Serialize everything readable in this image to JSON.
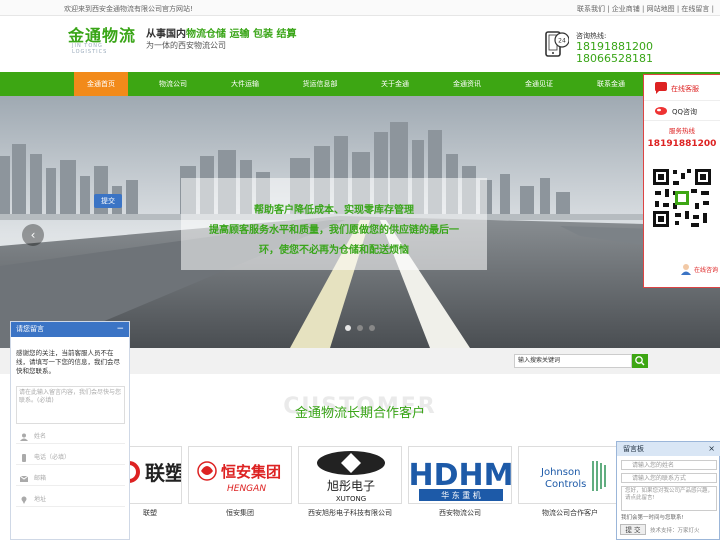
{
  "topbar": {
    "welcome": "欢迎来到西安金通物流有限公司官方网站!",
    "links": "联系我们 | 企业商铺 | 网站地图 | 在线留言 |"
  },
  "header": {
    "logo_cn": "金通物流",
    "logo_en": "JIN TONG LOGISTICS",
    "slogan_prefix": "从事国内",
    "slogan_highlight": "物流仓储 运输 包装 结算",
    "slogan_line2": "为一体的西安物流公司",
    "hotline_label": "咨询热线:",
    "phone1": "18191881200",
    "phone2": "18066528181"
  },
  "nav": {
    "items": [
      "金通首页",
      "物流公司",
      "大件运输",
      "货运信息部",
      "关于金通",
      "金通资讯",
      "金通见证",
      "联系金通"
    ]
  },
  "banner": {
    "line1": "帮助客户降低成本、实现零库存管理",
    "line2": "提高顾客服务水平和质量，我们愿做您的供应链的最后一",
    "line3": "环，使您不必再为仓储和配送烦恼",
    "prev": "‹",
    "next": "›"
  },
  "search": {
    "placeholder": "输入搜索关键词"
  },
  "section": {
    "watermark": "CUSTOMER",
    "title": "金通物流长期合作客户"
  },
  "clients": [
    {
      "logo": "联塑",
      "caption": "联塑"
    },
    {
      "logo": "恒安集团",
      "logo_en": "HENGAN",
      "caption": "恒安集团"
    },
    {
      "logo": "旭彤电子",
      "logo_en": "XUTONG",
      "caption": "西安旭彤电子科技有限公司"
    },
    {
      "logo": "HDHM",
      "logo_sub": "华 东 重 机",
      "caption": "西安物流公司"
    },
    {
      "logo": "Johnson",
      "logo_sub": "Controls",
      "caption": "物流公司合作客户"
    }
  ],
  "right_panel": {
    "online": "在线客服",
    "qq": "QQ咨询",
    "hot_label": "服务热线",
    "hot_phone": "18191881200",
    "consult": "在线咨询"
  },
  "chat": {
    "title": "请您留言",
    "close": "−",
    "message": "感谢您的关注，当前客服人员不在线，请填写一下您的信息，我们会尽快和您联系。",
    "textarea_placeholder": "请在此输入留言内容，我们会尽快与您联系。(必填)",
    "name": "姓名",
    "phone": "电话（必填）",
    "email": "邮箱",
    "address": "地址",
    "send": "提交"
  },
  "message_board": {
    "title": "留言板",
    "close": "×",
    "name_ph": "请输入您的姓名",
    "contact_ph": "请输入您的联系方式",
    "content_ph": "您好，如果您对我公司产品感兴趣，请点此留言!",
    "hint": "我们会第一时间与您联系!",
    "submit": "提 交",
    "support": "技术支持：万家灯火"
  },
  "colors": {
    "brand_green": "#3da613",
    "nav_active": "#f28a1a",
    "accent_red": "#d22222",
    "chat_blue": "#3b74c5"
  }
}
